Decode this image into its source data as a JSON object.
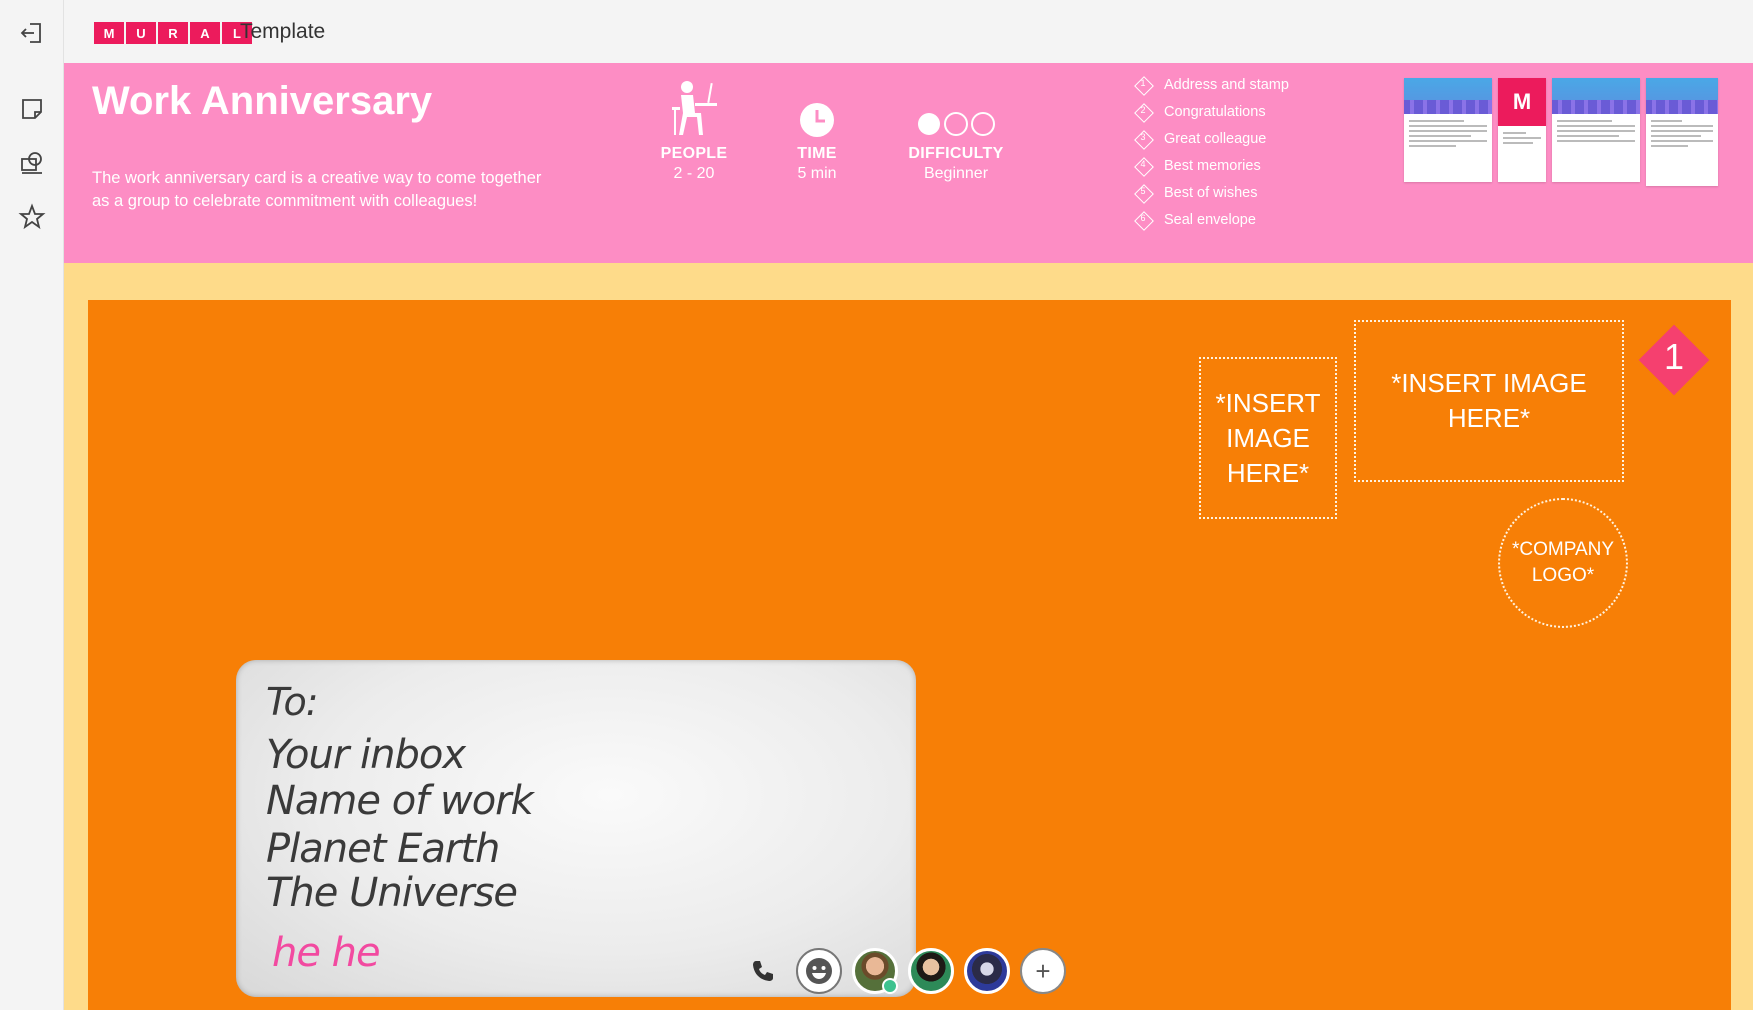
{
  "app": {
    "logo_letters": [
      "M",
      "U",
      "R",
      "A",
      "L"
    ],
    "title": "Template"
  },
  "sidebar": {
    "items": [
      {
        "name": "exit-icon"
      },
      {
        "name": "sticky-note-icon"
      },
      {
        "name": "shapes-icon"
      },
      {
        "name": "star-icon"
      }
    ]
  },
  "banner": {
    "title": "Work Anniversary",
    "description": "The work anniversary card is a creative way to come together as a group to celebrate commitment with colleagues!",
    "people": {
      "label": "PEOPLE",
      "value": "2 - 20"
    },
    "time": {
      "label": "TIME",
      "value": "5 min"
    },
    "difficulty": {
      "label": "DIFFICULTY",
      "value": "Beginner",
      "level": 1,
      "max_level": 3
    },
    "steps": [
      {
        "num": "1",
        "label": "Address and stamp"
      },
      {
        "num": "2",
        "label": "Congratulations"
      },
      {
        "num": "3",
        "label": "Great colleague"
      },
      {
        "num": "4",
        "label": "Best memories"
      },
      {
        "num": "5",
        "label": "Best of wishes"
      },
      {
        "num": "6",
        "label": "Seal envelope"
      }
    ],
    "thumbnail_letter": "M"
  },
  "envelope": {
    "image_placeholder_small": "*INSERT IMAGE HERE*",
    "image_placeholder_large": "*INSERT IMAGE HERE*",
    "logo_placeholder": "*COMPANY LOGO*",
    "step_number": "1",
    "address": {
      "to": "To:",
      "line1": "Your inbox",
      "line2": "Name of work",
      "line3": "Planet Earth",
      "line4": "The Universe",
      "note": "he he"
    }
  },
  "collab_bar": {
    "add_label": "+"
  },
  "colors": {
    "brand": "#ec1b5c",
    "banner": "#fd8dc4",
    "envelope": "#f77f06",
    "canvas": "#fedb8a"
  }
}
